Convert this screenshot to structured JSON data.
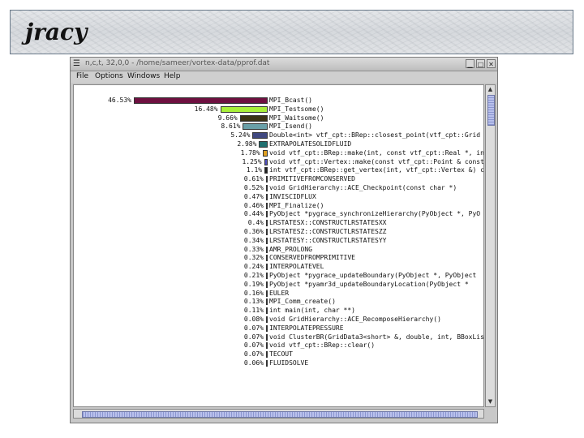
{
  "banner": {
    "title": "jracy"
  },
  "window": {
    "title": "n,c,t, 32,0,0 - /home/sameer/vortex-data/pprof.dat",
    "menus": [
      "File",
      "Options",
      "Windows",
      "Help"
    ],
    "menu_icon": "window-menu-icon",
    "minimize_icon": "minimize-icon",
    "maximize_icon": "maximize-icon",
    "close_icon": "close-icon"
  },
  "profile": {
    "rows": [
      {
        "pct": "46.53%",
        "value": 46.53,
        "color": "#6e1040",
        "name": "MPI_Bcast()"
      },
      {
        "pct": "16.48%",
        "value": 16.48,
        "color": "#a8f03a",
        "name": "MPI_Testsome()"
      },
      {
        "pct": "9.66%",
        "value": 9.66,
        "color": "#3a3214",
        "name": "MPI_Waitsome()"
      },
      {
        "pct": "8.61%",
        "value": 8.61,
        "color": "#6aa0a8",
        "name": "MPI_Isend()"
      },
      {
        "pct": "5.24%",
        "value": 5.24,
        "color": "#404880",
        "name": "Double<int> vtf_cpt::BRep::closest_point(vtf_cpt::Grid &"
      },
      {
        "pct": "2.98%",
        "value": 2.98,
        "color": "#207070",
        "name": "EXTRAPOLATESOLIDFLUID"
      },
      {
        "pct": "1.78%",
        "value": 1.78,
        "color": "#e0a020",
        "name": "void vtf_cpt::BRep::make(int, const vtf_cpt::Real *, int, con"
      },
      {
        "pct": "1.25%",
        "value": 1.25,
        "color": "#5050c0",
        "name": "void vtf_cpt::Vertex::make(const vtf_cpt::Point & const st"
      },
      {
        "pct": "1.1%",
        "value": 1.1,
        "color": "#202020",
        "name": "int vtf_cpt::BRep::get_vertex(int, vtf_cpt::Vertex &) const"
      },
      {
        "pct": "0.61%",
        "value": 0.61,
        "color": "#303030",
        "name": "PRIMITIVEFROMCONSERVED"
      },
      {
        "pct": "0.52%",
        "value": 0.52,
        "color": "#303030",
        "name": "void GridHierarchy::ACE_Checkpoint(const char *)"
      },
      {
        "pct": "0.47%",
        "value": 0.47,
        "color": "#303030",
        "name": "INVISCIDFLUX"
      },
      {
        "pct": "0.46%",
        "value": 0.46,
        "color": "#303030",
        "name": "MPI_Finalize()"
      },
      {
        "pct": "0.44%",
        "value": 0.44,
        "color": "#303030",
        "name": "PyObject *pygrace_synchronizeHierarchy(PyObject *, PyO"
      },
      {
        "pct": "0.4%",
        "value": 0.4,
        "color": "#303030",
        "name": "LRSTATESX::CONSTRUCTLRSTATESXX"
      },
      {
        "pct": "0.36%",
        "value": 0.36,
        "color": "#303030",
        "name": "LRSTATESZ::CONSTRUCTLRSTATESZZ"
      },
      {
        "pct": "0.34%",
        "value": 0.34,
        "color": "#303030",
        "name": "LRSTATESY::CONSTRUCTLRSTATESYY"
      },
      {
        "pct": "0.33%",
        "value": 0.33,
        "color": "#303030",
        "name": "AMR_PROLONG"
      },
      {
        "pct": "0.32%",
        "value": 0.32,
        "color": "#303030",
        "name": "CONSERVEDFROMPRIMITIVE"
      },
      {
        "pct": "0.24%",
        "value": 0.24,
        "color": "#303030",
        "name": "INTERPOLATEVEL"
      },
      {
        "pct": "0.21%",
        "value": 0.21,
        "color": "#303030",
        "name": "PyObject *pygrace_updateBoundary(PyObject *, PyObject"
      },
      {
        "pct": "0.19%",
        "value": 0.19,
        "color": "#303030",
        "name": "PyObject *pyamr3d_updateBoundaryLocation(PyObject *"
      },
      {
        "pct": "0.16%",
        "value": 0.16,
        "color": "#303030",
        "name": "EULER"
      },
      {
        "pct": "0.13%",
        "value": 0.13,
        "color": "#303030",
        "name": "MPI_Comm_create()"
      },
      {
        "pct": "0.11%",
        "value": 0.11,
        "color": "#303030",
        "name": "int main(int, char **)"
      },
      {
        "pct": "0.08%",
        "value": 0.08,
        "color": "#303030",
        "name": "void GridHierarchy::ACE_RecomposeHierarchy()"
      },
      {
        "pct": "0.07%",
        "value": 0.07,
        "color": "#303030",
        "name": "INTERPOLATEPRESSURE"
      },
      {
        "pct": "0.07%",
        "value": 0.07,
        "color": "#303030",
        "name": "void ClusterBR(GridData3<short> &, double, int, BBoxLis"
      },
      {
        "pct": "0.07%",
        "value": 0.07,
        "color": "#303030",
        "name": "void vtf_cpt::BRep::clear()"
      },
      {
        "pct": "0.07%",
        "value": 0.07,
        "color": "#303030",
        "name": "TECOUT"
      },
      {
        "pct": "0.06%",
        "value": 0.06,
        "color": "#303030",
        "name": "FLUIDSOLVE"
      }
    ]
  }
}
